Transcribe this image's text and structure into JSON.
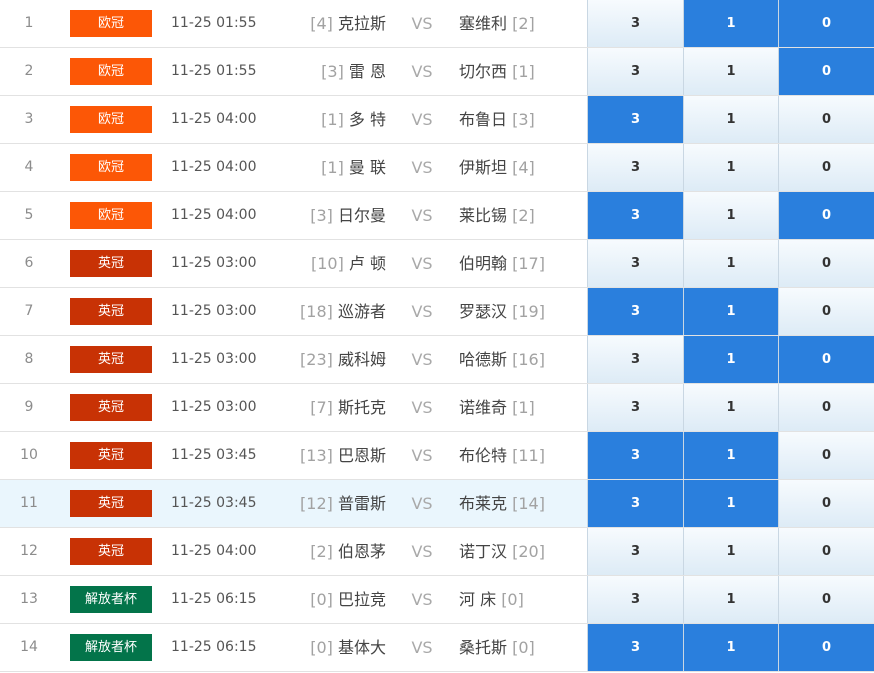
{
  "colors": {
    "badge_ucl": "#fc5706",
    "badge_efl": "#c83205",
    "badge_copa": "#03744a",
    "option_selected": "#2a7fdd"
  },
  "vs_label": "VS",
  "matches": [
    {
      "no": "1",
      "league": "欧冠",
      "league_color": "#fc5706",
      "time": "11-25 01:55",
      "home_rank": "[4]",
      "home": "克拉斯",
      "away": "塞维利",
      "away_rank": "[2]",
      "opts": [
        "3",
        "1",
        "0"
      ],
      "selected": [
        false,
        true,
        true
      ]
    },
    {
      "no": "2",
      "league": "欧冠",
      "league_color": "#fc5706",
      "time": "11-25 01:55",
      "home_rank": "[3]",
      "home": "雷 恩",
      "away": "切尔西",
      "away_rank": "[1]",
      "opts": [
        "3",
        "1",
        "0"
      ],
      "selected": [
        false,
        false,
        true
      ]
    },
    {
      "no": "3",
      "league": "欧冠",
      "league_color": "#fc5706",
      "time": "11-25 04:00",
      "home_rank": "[1]",
      "home": "多 特",
      "away": "布鲁日",
      "away_rank": "[3]",
      "opts": [
        "3",
        "1",
        "0"
      ],
      "selected": [
        true,
        false,
        false
      ]
    },
    {
      "no": "4",
      "league": "欧冠",
      "league_color": "#fc5706",
      "time": "11-25 04:00",
      "home_rank": "[1]",
      "home": "曼 联",
      "away": "伊斯坦",
      "away_rank": "[4]",
      "opts": [
        "3",
        "1",
        "0"
      ],
      "selected": [
        false,
        false,
        false
      ]
    },
    {
      "no": "5",
      "league": "欧冠",
      "league_color": "#fc5706",
      "time": "11-25 04:00",
      "home_rank": "[3]",
      "home": "日尔曼",
      "away": "莱比锡",
      "away_rank": "[2]",
      "opts": [
        "3",
        "1",
        "0"
      ],
      "selected": [
        true,
        false,
        true
      ]
    },
    {
      "no": "6",
      "league": "英冠",
      "league_color": "#c83205",
      "time": "11-25 03:00",
      "home_rank": "[10]",
      "home": "卢 顿",
      "away": "伯明翰",
      "away_rank": "[17]",
      "opts": [
        "3",
        "1",
        "0"
      ],
      "selected": [
        false,
        false,
        false
      ]
    },
    {
      "no": "7",
      "league": "英冠",
      "league_color": "#c83205",
      "time": "11-25 03:00",
      "home_rank": "[18]",
      "home": "巡游者",
      "away": "罗瑟汉",
      "away_rank": "[19]",
      "opts": [
        "3",
        "1",
        "0"
      ],
      "selected": [
        true,
        true,
        false
      ]
    },
    {
      "no": "8",
      "league": "英冠",
      "league_color": "#c83205",
      "time": "11-25 03:00",
      "home_rank": "[23]",
      "home": "威科姆",
      "away": "哈德斯",
      "away_rank": "[16]",
      "opts": [
        "3",
        "1",
        "0"
      ],
      "selected": [
        false,
        true,
        true
      ]
    },
    {
      "no": "9",
      "league": "英冠",
      "league_color": "#c83205",
      "time": "11-25 03:00",
      "home_rank": "[7]",
      "home": "斯托克",
      "away": "诺维奇",
      "away_rank": "[1]",
      "opts": [
        "3",
        "1",
        "0"
      ],
      "selected": [
        false,
        false,
        false
      ]
    },
    {
      "no": "10",
      "league": "英冠",
      "league_color": "#c83205",
      "time": "11-25 03:45",
      "home_rank": "[13]",
      "home": "巴恩斯",
      "away": "布伦特",
      "away_rank": "[11]",
      "opts": [
        "3",
        "1",
        "0"
      ],
      "selected": [
        true,
        true,
        false
      ]
    },
    {
      "no": "11",
      "league": "英冠",
      "league_color": "#c83205",
      "time": "11-25 03:45",
      "home_rank": "[12]",
      "home": "普雷斯",
      "away": "布莱克",
      "away_rank": "[14]",
      "opts": [
        "3",
        "1",
        "0"
      ],
      "selected": [
        true,
        true,
        false
      ],
      "highlighted": true
    },
    {
      "no": "12",
      "league": "英冠",
      "league_color": "#c83205",
      "time": "11-25 04:00",
      "home_rank": "[2]",
      "home": "伯恩茅",
      "away": "诺丁汉",
      "away_rank": "[20]",
      "opts": [
        "3",
        "1",
        "0"
      ],
      "selected": [
        false,
        false,
        false
      ]
    },
    {
      "no": "13",
      "league": "解放者杯",
      "league_color": "#03744a",
      "time": "11-25 06:15",
      "home_rank": "[0]",
      "home": "巴拉竞",
      "away": "河 床",
      "away_rank": "[0]",
      "opts": [
        "3",
        "1",
        "0"
      ],
      "selected": [
        false,
        false,
        false
      ]
    },
    {
      "no": "14",
      "league": "解放者杯",
      "league_color": "#03744a",
      "time": "11-25 06:15",
      "home_rank": "[0]",
      "home": "基体大",
      "away": "桑托斯",
      "away_rank": "[0]",
      "opts": [
        "3",
        "1",
        "0"
      ],
      "selected": [
        true,
        true,
        true
      ]
    }
  ]
}
